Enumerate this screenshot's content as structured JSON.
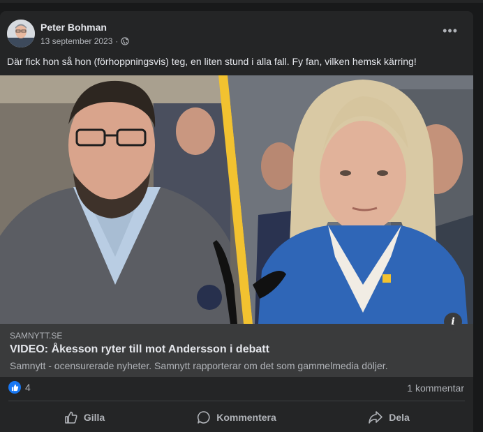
{
  "post": {
    "author": "Peter Bohman",
    "date": "13 september 2023",
    "date_separator": "·",
    "text": "Där fick hon så hon (förhoppningsvis) teg, en liten stund i alla fall. Fy fan, vilken hemsk kärring!",
    "more_label": "•••"
  },
  "link_preview": {
    "domain": "SAMNYTT.SE",
    "title": "VIDEO: Åkesson ryter till mot Andersson i debatt",
    "description": "Samnytt - ocensurerade nyheter. Samnytt rapporterar om det som gammelmedia döljer.",
    "info_label": "i"
  },
  "stats": {
    "reaction_count": "4",
    "comment_count": "1 kommentar"
  },
  "actions": {
    "like": "Gilla",
    "comment": "Kommentera",
    "share": "Dela"
  },
  "colors": {
    "background": "#18191a",
    "card": "#242526",
    "preview": "#3a3b3c",
    "like_blue": "#1877f2",
    "divider_yellow": "#f2c230"
  }
}
